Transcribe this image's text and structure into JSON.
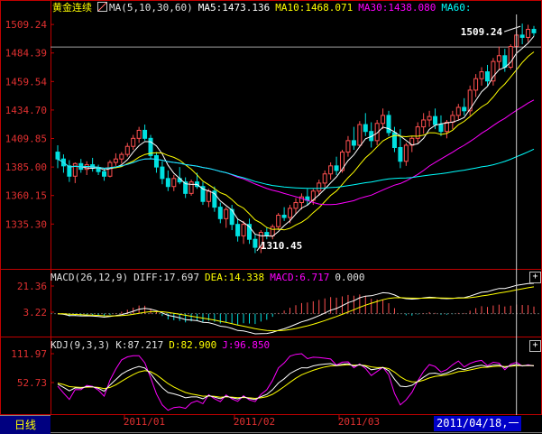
{
  "main_panel": {
    "instrument": "黄金连续",
    "indicator_icon": "chart-icon",
    "ma_label": "MA(5,10,30,60)",
    "ma5": "MA5:1473.136",
    "ma10": "MA10:1468.071",
    "ma30": "MA30:1438.080",
    "ma60": "MA60:",
    "high_label": "1509.24",
    "low_label": "1310.45"
  },
  "macd_panel": {
    "name": "MACD(26,12,9)",
    "diff": "DIFF:17.697",
    "dea": "DEA:14.338",
    "macd": "MACD:6.717",
    "extra": "0.000"
  },
  "kdj_panel": {
    "name": "KDJ(9,3,3)",
    "k": "K:87.217",
    "d": "D:82.900",
    "j": "J:96.850"
  },
  "bottom": {
    "period_tab": "日线",
    "cursor_date": "2011/04/18,一"
  },
  "colors": {
    "background": "#000000",
    "axis": "#c00000",
    "up": "#ff5050",
    "down": "#00e0e0",
    "ma5": "#ffffff",
    "ma10": "#ffff00",
    "ma30": "#ff00ff",
    "ma60": "#00ffff"
  },
  "chart_data": [
    {
      "type": "candlestick",
      "title": "黄金连续",
      "y_ticks": [
        1509.24,
        1484.39,
        1459.54,
        1434.7,
        1409.85,
        1385.0,
        1360.15,
        1335.3
      ],
      "ylim": [
        1297,
        1518
      ],
      "x_ticks": [
        "2011/01",
        "2011/02",
        "2011/03"
      ],
      "annotations": [
        {
          "label": "1509.24",
          "value": 1509.24
        },
        {
          "label": "1310.45",
          "value": 1310.45
        }
      ],
      "ohlc": [
        [
          1398,
          1404,
          1384,
          1392
        ],
        [
          1392,
          1396,
          1380,
          1386
        ],
        [
          1386,
          1391,
          1372,
          1377
        ],
        [
          1377,
          1389,
          1371,
          1388
        ],
        [
          1388,
          1392,
          1380,
          1383
        ],
        [
          1383,
          1390,
          1378,
          1387
        ],
        [
          1387,
          1393,
          1381,
          1384
        ],
        [
          1384,
          1387,
          1378,
          1381
        ],
        [
          1381,
          1384,
          1373,
          1377
        ],
        [
          1377,
          1391,
          1376,
          1389
        ],
        [
          1389,
          1397,
          1386,
          1392
        ],
        [
          1392,
          1398,
          1388,
          1396
        ],
        [
          1396,
          1406,
          1394,
          1403
        ],
        [
          1403,
          1413,
          1400,
          1410
        ],
        [
          1410,
          1420,
          1406,
          1417
        ],
        [
          1417,
          1422,
          1408,
          1410
        ],
        [
          1410,
          1413,
          1392,
          1395
        ],
        [
          1395,
          1398,
          1380,
          1385
        ],
        [
          1385,
          1390,
          1370,
          1375
        ],
        [
          1375,
          1382,
          1364,
          1368
        ],
        [
          1368,
          1378,
          1364,
          1375
        ],
        [
          1375,
          1385,
          1370,
          1372
        ],
        [
          1372,
          1376,
          1358,
          1362
        ],
        [
          1362,
          1374,
          1360,
          1372
        ],
        [
          1372,
          1380,
          1366,
          1368
        ],
        [
          1368,
          1372,
          1352,
          1355
        ],
        [
          1355,
          1366,
          1350,
          1364
        ],
        [
          1364,
          1368,
          1346,
          1350
        ],
        [
          1350,
          1354,
          1336,
          1340
        ],
        [
          1340,
          1350,
          1332,
          1348
        ],
        [
          1348,
          1352,
          1330,
          1335
        ],
        [
          1335,
          1340,
          1320,
          1325
        ],
        [
          1325,
          1338,
          1318,
          1335
        ],
        [
          1335,
          1340,
          1318,
          1322
        ],
        [
          1322,
          1326,
          1310,
          1315
        ],
        [
          1315,
          1330,
          1310,
          1328
        ],
        [
          1328,
          1332,
          1322,
          1325
        ],
        [
          1325,
          1335,
          1322,
          1333
        ],
        [
          1333,
          1345,
          1330,
          1343
        ],
        [
          1343,
          1350,
          1338,
          1341
        ],
        [
          1341,
          1352,
          1336,
          1349
        ],
        [
          1349,
          1358,
          1344,
          1354
        ],
        [
          1354,
          1362,
          1348,
          1359
        ],
        [
          1359,
          1366,
          1352,
          1356
        ],
        [
          1356,
          1366,
          1352,
          1364
        ],
        [
          1364,
          1374,
          1360,
          1371
        ],
        [
          1371,
          1382,
          1366,
          1379
        ],
        [
          1379,
          1389,
          1374,
          1386
        ],
        [
          1386,
          1394,
          1378,
          1382
        ],
        [
          1382,
          1400,
          1380,
          1398
        ],
        [
          1398,
          1412,
          1394,
          1408
        ],
        [
          1408,
          1420,
          1400,
          1404
        ],
        [
          1404,
          1425,
          1402,
          1422
        ],
        [
          1422,
          1432,
          1412,
          1416
        ],
        [
          1416,
          1424,
          1402,
          1408
        ],
        [
          1408,
          1426,
          1404,
          1423
        ],
        [
          1423,
          1436,
          1418,
          1430
        ],
        [
          1430,
          1434,
          1412,
          1415
        ],
        [
          1415,
          1420,
          1398,
          1402
        ],
        [
          1402,
          1418,
          1384,
          1390
        ],
        [
          1390,
          1406,
          1386,
          1404
        ],
        [
          1404,
          1412,
          1398,
          1410
        ],
        [
          1410,
          1424,
          1406,
          1420
        ],
        [
          1420,
          1432,
          1414,
          1426
        ],
        [
          1426,
          1434,
          1420,
          1429
        ],
        [
          1429,
          1436,
          1418,
          1422
        ],
        [
          1422,
          1430,
          1412,
          1416
        ],
        [
          1416,
          1426,
          1410,
          1424
        ],
        [
          1424,
          1434,
          1418,
          1430
        ],
        [
          1430,
          1440,
          1426,
          1437
        ],
        [
          1437,
          1445,
          1430,
          1434
        ],
        [
          1434,
          1456,
          1430,
          1452
        ],
        [
          1452,
          1466,
          1446,
          1462
        ],
        [
          1462,
          1472,
          1456,
          1468
        ],
        [
          1468,
          1474,
          1456,
          1460
        ],
        [
          1460,
          1480,
          1456,
          1477
        ],
        [
          1477,
          1490,
          1470,
          1482
        ],
        [
          1482,
          1488,
          1468,
          1472
        ],
        [
          1472,
          1492,
          1470,
          1490
        ],
        [
          1490,
          1504,
          1484,
          1500
        ],
        [
          1500,
          1510,
          1492,
          1498
        ],
        [
          1498,
          1509,
          1494,
          1505
        ],
        [
          1505,
          1508,
          1499,
          1502
        ]
      ]
    },
    {
      "type": "bar",
      "title": "MACD(26,12,9)",
      "y_ticks": [
        21.36,
        3.22
      ],
      "series_names": [
        "DIFF",
        "DEA",
        "MACD"
      ],
      "latest": {
        "DIFF": 17.697,
        "DEA": 14.338,
        "MACD": 6.717
      }
    },
    {
      "type": "line",
      "title": "KDJ(9,3,3)",
      "y_ticks": [
        111.97,
        52.73
      ],
      "series_names": [
        "K",
        "D",
        "J"
      ],
      "latest": {
        "K": 87.217,
        "D": 82.9,
        "J": 96.85
      }
    }
  ]
}
